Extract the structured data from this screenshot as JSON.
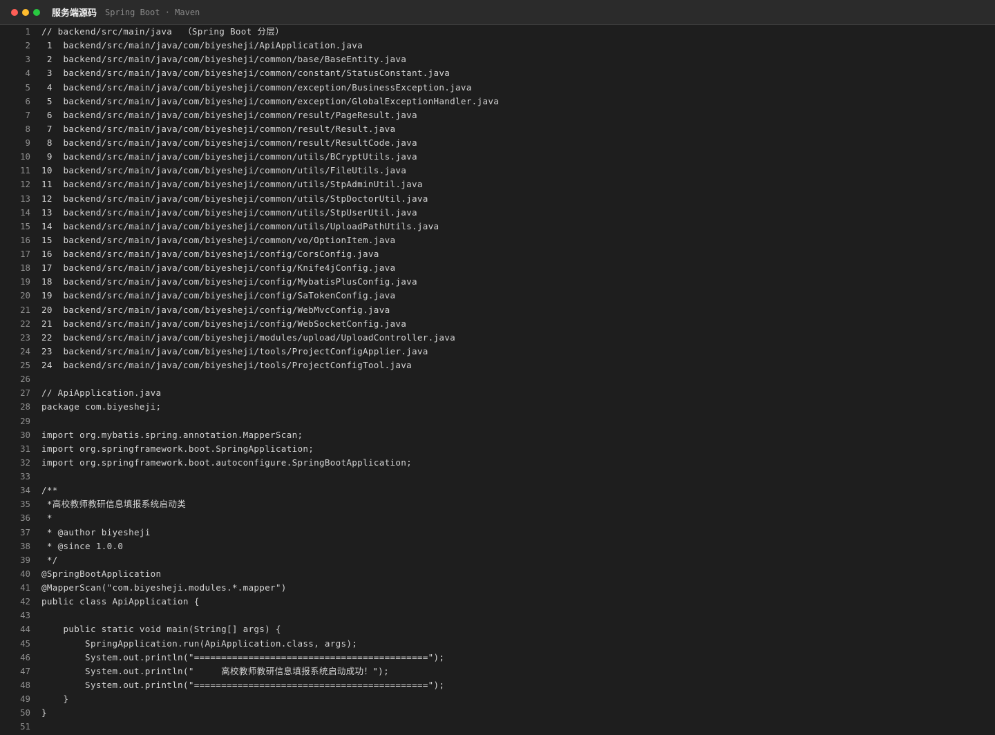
{
  "window": {
    "title": "服务端源码",
    "subtitle": "Spring Boot · Maven"
  },
  "lines": [
    "// backend/src/main/java  （Spring Boot 分层）",
    " 1  backend/src/main/java/com/biyesheji/ApiApplication.java",
    " 2  backend/src/main/java/com/biyesheji/common/base/BaseEntity.java",
    " 3  backend/src/main/java/com/biyesheji/common/constant/StatusConstant.java",
    " 4  backend/src/main/java/com/biyesheji/common/exception/BusinessException.java",
    " 5  backend/src/main/java/com/biyesheji/common/exception/GlobalExceptionHandler.java",
    " 6  backend/src/main/java/com/biyesheji/common/result/PageResult.java",
    " 7  backend/src/main/java/com/biyesheji/common/result/Result.java",
    " 8  backend/src/main/java/com/biyesheji/common/result/ResultCode.java",
    " 9  backend/src/main/java/com/biyesheji/common/utils/BCryptUtils.java",
    "10  backend/src/main/java/com/biyesheji/common/utils/FileUtils.java",
    "11  backend/src/main/java/com/biyesheji/common/utils/StpAdminUtil.java",
    "12  backend/src/main/java/com/biyesheji/common/utils/StpDoctorUtil.java",
    "13  backend/src/main/java/com/biyesheji/common/utils/StpUserUtil.java",
    "14  backend/src/main/java/com/biyesheji/common/utils/UploadPathUtils.java",
    "15  backend/src/main/java/com/biyesheji/common/vo/OptionItem.java",
    "16  backend/src/main/java/com/biyesheji/config/CorsConfig.java",
    "17  backend/src/main/java/com/biyesheji/config/Knife4jConfig.java",
    "18  backend/src/main/java/com/biyesheji/config/MybatisPlusConfig.java",
    "19  backend/src/main/java/com/biyesheji/config/SaTokenConfig.java",
    "20  backend/src/main/java/com/biyesheji/config/WebMvcConfig.java",
    "21  backend/src/main/java/com/biyesheji/config/WebSocketConfig.java",
    "22  backend/src/main/java/com/biyesheji/modules/upload/UploadController.java",
    "23  backend/src/main/java/com/biyesheji/tools/ProjectConfigApplier.java",
    "24  backend/src/main/java/com/biyesheji/tools/ProjectConfigTool.java",
    "",
    "// ApiApplication.java",
    "package com.biyesheji;",
    "",
    "import org.mybatis.spring.annotation.MapperScan;",
    "import org.springframework.boot.SpringApplication;",
    "import org.springframework.boot.autoconfigure.SpringBootApplication;",
    "",
    "/**",
    " *高校教师教研信息填报系统启动类",
    " *",
    " * @author biyesheji",
    " * @since 1.0.0",
    " */",
    "@SpringBootApplication",
    "@MapperScan(\"com.biyesheji.modules.*.mapper\")",
    "public class ApiApplication {",
    "",
    "    public static void main(String[] args) {",
    "        SpringApplication.run(ApiApplication.class, args);",
    "        System.out.println(\"===========================================\");",
    "        System.out.println(\"     高校教师教研信息填报系统启动成功！\");",
    "        System.out.println(\"===========================================\");",
    "    }",
    "}",
    ""
  ]
}
